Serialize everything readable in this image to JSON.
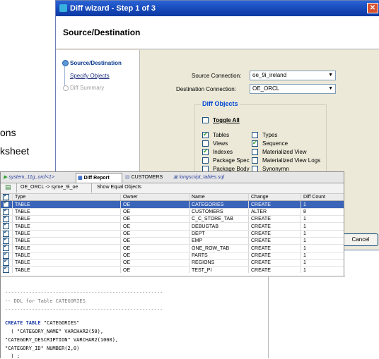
{
  "background_text": {
    "line1": "ons",
    "line2": "ksheet"
  },
  "wizard": {
    "title": "Diff wizard - Step 1 of 3",
    "header": "Source/Destination",
    "nav": [
      "Source/Destination",
      "Specify Objects",
      "Diff Summary"
    ],
    "source_label": "Source Connection:",
    "source_value": "oe_9i_ireland",
    "dest_label": "Destination Connection:",
    "dest_value": "OE_ORCL",
    "group_title": "Diff Objects",
    "toggle_all": "Toggle All",
    "objects": [
      {
        "label": "Tables",
        "checked": true
      },
      {
        "label": "Types",
        "checked": false
      },
      {
        "label": "Views",
        "checked": false
      },
      {
        "label": "Sequence",
        "checked": true
      },
      {
        "label": "Indexes",
        "checked": true
      },
      {
        "label": "Materialized View",
        "checked": false
      },
      {
        "label": "Package Spec",
        "checked": false
      },
      {
        "label": "Materialized View Logs",
        "checked": false
      },
      {
        "label": "Package Body",
        "checked": false
      },
      {
        "label": "Synonymn",
        "checked": false
      }
    ],
    "cancel": "Cancel"
  },
  "worksheet": {
    "tabs": [
      "system_11g_orcl<1>",
      "Diff Report",
      "CUSTOMERS",
      "longscript_tables.sql"
    ],
    "toolbar_text": "OE_ORCL -> syme_9i_oe",
    "show_equal": "Show Equal Objects",
    "columns": [
      "Type",
      "Owner",
      "Name",
      "Change",
      "Diff Count"
    ],
    "rows": [
      [
        "TABLE",
        "OE",
        "CATEGORIES",
        "CREATE",
        "1"
      ],
      [
        "TABLE",
        "OE",
        "CUSTOMERS",
        "ALTER",
        "8"
      ],
      [
        "TABLE",
        "OE",
        "C_C_STORE_TAB",
        "CREATE",
        "1"
      ],
      [
        "TABLE",
        "OE",
        "DEBUGTAB",
        "CREATE",
        "1"
      ],
      [
        "TABLE",
        "OE",
        "DEPT",
        "CREATE",
        "1"
      ],
      [
        "TABLE",
        "OE",
        "EMP",
        "CREATE",
        "1"
      ],
      [
        "TABLE",
        "OE",
        "ONE_ROW_TAB",
        "CREATE",
        "1"
      ],
      [
        "TABLE",
        "OE",
        "PARTS",
        "CREATE",
        "1"
      ],
      [
        "TABLE",
        "OE",
        "REGIONS",
        "CREATE",
        "1"
      ],
      [
        "TABLE",
        "OE",
        "TEST_PI",
        "CREATE",
        "1"
      ]
    ],
    "ddl": {
      "divider": "-----------------------------------------------------",
      "comment": "-- DDL for Table CATEGORIES",
      "create_kw": "CREATE TABLE",
      "create_rest": " \"CATEGORIES\"",
      "col1": "  ( \"CATEGORY_NAME\" VARCHAR2(50),",
      "col2": "\"CATEGORY_DESCRIPTION\" VARCHAR2(1000),",
      "col3": "\"CATEGORY_ID\" NUMBER(2,0)",
      "end": "  ) ;"
    }
  }
}
